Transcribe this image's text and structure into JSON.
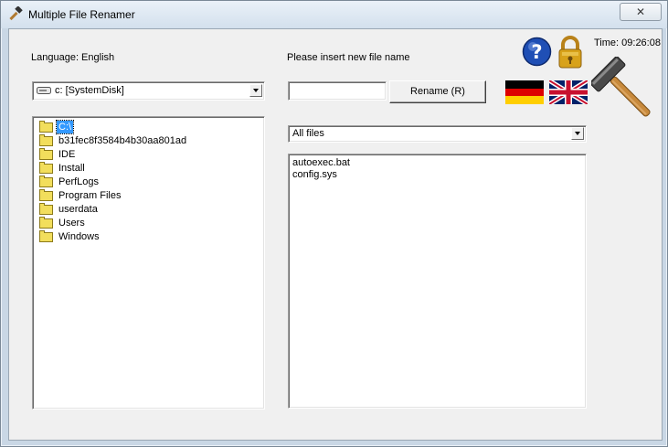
{
  "window": {
    "title": "Multiple File Renamer",
    "close_glyph": "✕"
  },
  "left": {
    "language_label": "Language: English",
    "drive_combo": {
      "value": "c: [SystemDisk]",
      "icon": "drive-icon"
    },
    "folders": [
      {
        "label": "C:\\",
        "selected": true
      },
      {
        "label": "b31fec8f3584b4b30aa801ad"
      },
      {
        "label": "IDE"
      },
      {
        "label": "Install"
      },
      {
        "label": "PerfLogs"
      },
      {
        "label": "Program Files"
      },
      {
        "label": "userdata"
      },
      {
        "label": "Users"
      },
      {
        "label": "Windows"
      }
    ]
  },
  "center": {
    "new_name_label": "Please insert new file name",
    "new_name_value": "",
    "rename_button": "Rename (R)",
    "filter_combo": {
      "value": "All files"
    },
    "files": [
      "autoexec.bat",
      "config.sys"
    ]
  },
  "right": {
    "time_label": "Time: 09:26:08",
    "icons": [
      "help-icon",
      "lock-icon",
      "german-flag-icon",
      "uk-flag-icon",
      "hammer-icon"
    ]
  },
  "colors": {
    "selection": "#3399ff",
    "help_blue": "#1f4fb5",
    "lock_gold": "#d8a21a",
    "hammer_handle": "#c88a3c"
  }
}
